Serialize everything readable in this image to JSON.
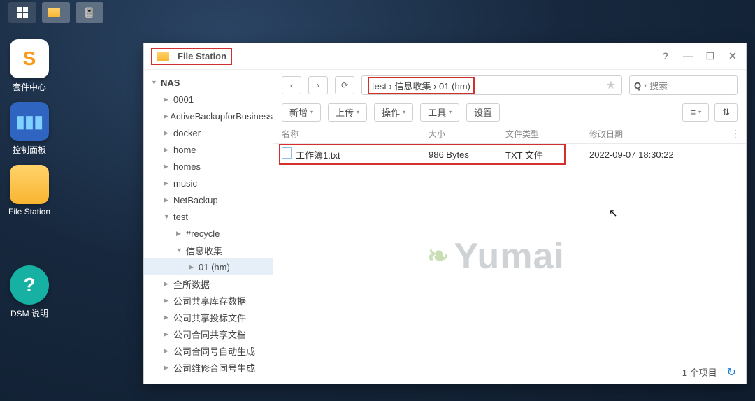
{
  "taskbar_icons": [
    "apps",
    "file-station",
    "control-panel"
  ],
  "desktop": {
    "pkg": "套件中心",
    "ctrl": "控制面板",
    "fs": "File Station",
    "dsm_label1": "DSM 说明",
    "dsm_label2": ""
  },
  "window": {
    "title": "File Station",
    "controls": {
      "help": "?",
      "min": "—",
      "max": "☐",
      "close": "✕"
    }
  },
  "sidebar": {
    "root": "NAS",
    "items": [
      {
        "label": "0001",
        "level": 1
      },
      {
        "label": "ActiveBackupforBusiness",
        "level": 1
      },
      {
        "label": "docker",
        "level": 1
      },
      {
        "label": "home",
        "level": 1
      },
      {
        "label": "homes",
        "level": 1
      },
      {
        "label": "music",
        "level": 1
      },
      {
        "label": "NetBackup",
        "level": 1
      },
      {
        "label": "test",
        "level": 1,
        "expanded": true
      },
      {
        "label": "#recycle",
        "level": 2
      },
      {
        "label": "信息收集",
        "level": 2,
        "expanded": true
      },
      {
        "label": "01 (hm)",
        "level": 3,
        "selected": true
      },
      {
        "label": "全所数据",
        "level": 1
      },
      {
        "label": "公司共享库存数据",
        "level": 1
      },
      {
        "label": "公司共享投标文件",
        "level": 1
      },
      {
        "label": "公司合同共享文档",
        "level": 1
      },
      {
        "label": "公司合同号自动生成",
        "level": 1
      },
      {
        "label": "公司维修合同号生成",
        "level": 1
      }
    ]
  },
  "breadcrumb": "test › 信息收集 › 01 (hm)",
  "search_placeholder": "搜索",
  "toolbar": {
    "new": "新增",
    "upload": "上传",
    "operate": "操作",
    "tools": "工具",
    "settings": "设置"
  },
  "columns": {
    "name": "名称",
    "size": "大小",
    "type": "文件类型",
    "date": "修改日期"
  },
  "files": [
    {
      "name": "工作簿1.txt",
      "size": "986 Bytes",
      "type": "TXT 文件",
      "date": "2022-09-07 18:30:22"
    }
  ],
  "status": {
    "count": "1 个项目"
  },
  "watermark": "Yumai"
}
